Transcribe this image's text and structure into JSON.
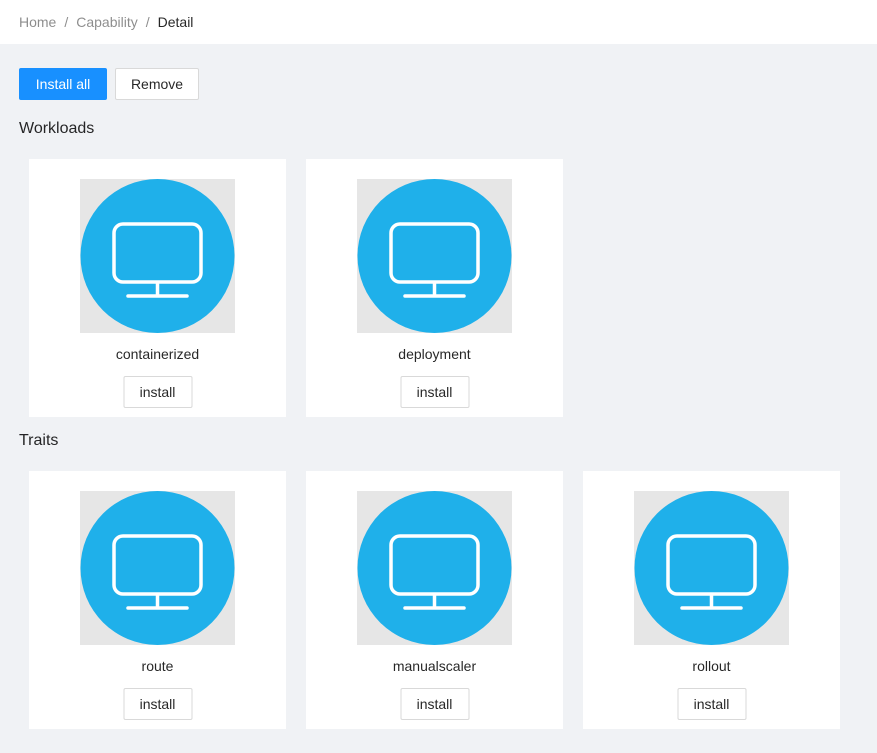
{
  "breadcrumb": {
    "items": [
      "Home",
      "Capability",
      "Detail"
    ],
    "separator": "/"
  },
  "toolbar": {
    "install_all_label": "Install all",
    "remove_label": "Remove"
  },
  "sections": {
    "workloads": {
      "title": "Workloads",
      "items": [
        {
          "name": "containerized",
          "button": "install",
          "icon": "monitor-icon"
        },
        {
          "name": "deployment",
          "button": "install",
          "icon": "monitor-icon"
        }
      ]
    },
    "traits": {
      "title": "Traits",
      "items": [
        {
          "name": "route",
          "button": "install",
          "icon": "monitor-icon"
        },
        {
          "name": "manualscaler",
          "button": "install",
          "icon": "monitor-icon"
        },
        {
          "name": "rollout",
          "button": "install",
          "icon": "monitor-icon"
        }
      ]
    }
  },
  "colors": {
    "primary": "#1890ff",
    "icon_circle": "#1fb0ea",
    "page_background": "#f0f2f5"
  }
}
